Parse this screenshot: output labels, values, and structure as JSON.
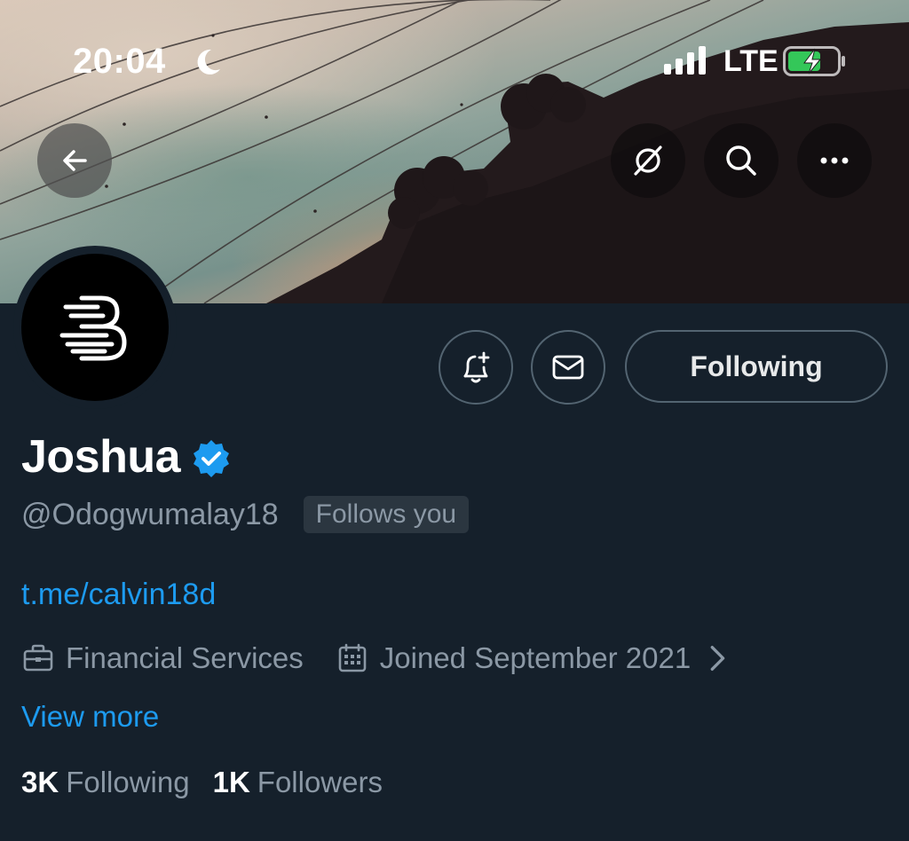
{
  "status_bar": {
    "time": "20:04",
    "network": "LTE",
    "icons": [
      "moon-icon",
      "signal-icon",
      "battery-charging-icon"
    ]
  },
  "header": {
    "icons": [
      "back-arrow-icon",
      "grok-icon",
      "search-icon",
      "more-icon"
    ]
  },
  "profile": {
    "avatar_icon": "bitmart-b-logo",
    "display_name": "Joshua",
    "verified": true,
    "handle": "@Odogwumalay18",
    "follows_you_label": "Follows you",
    "link": "t.me/calvin18d",
    "category": "Financial Services",
    "joined": "Joined September 2021",
    "view_more_label": "View more",
    "following_count": "3K",
    "following_label": "Following",
    "followers_count": "1K",
    "followers_label": "Followers"
  },
  "actions": {
    "notify_icon": "bell-plus-icon",
    "message_icon": "envelope-icon",
    "following_button_label": "Following"
  },
  "colors": {
    "background": "#15202b",
    "accent_blue": "#1d9bf0",
    "secondary_text": "#8b98a5",
    "border": "#536471",
    "battery_green": "#34c759"
  }
}
